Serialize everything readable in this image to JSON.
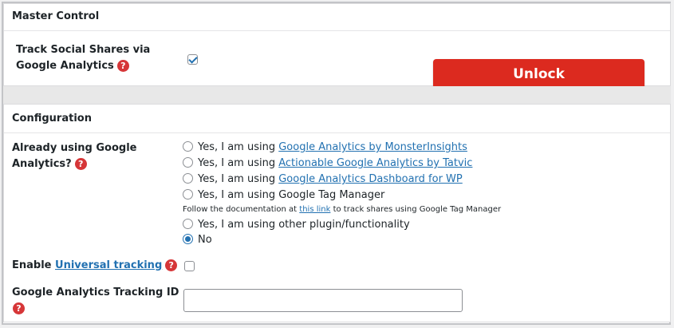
{
  "master": {
    "title": "Master Control",
    "track_label_line1": "Track Social Shares via",
    "track_label_line2": "Google Analytics",
    "track_checked": true,
    "unlock_label": "Unlock"
  },
  "config": {
    "title": "Configuration",
    "already_label_line1": "Already using Google",
    "already_label_line2": "Analytics?",
    "options": [
      {
        "prefix": "Yes, I am using ",
        "link": "Google Analytics by MonsterInsights",
        "selected": false
      },
      {
        "prefix": "Yes, I am using ",
        "link": "Actionable Google Analytics by Tatvic",
        "selected": false
      },
      {
        "prefix": "Yes, I am using ",
        "link": "Google Analytics Dashboard for WP",
        "selected": false
      },
      {
        "prefix": "Yes, I am using Google Tag Manager",
        "link": "",
        "selected": false
      }
    ],
    "note_before": "Follow the documentation at ",
    "note_link": "this link",
    "note_after": " to track shares using Google Tag Manager",
    "option_other": "Yes, I am using other plugin/functionality",
    "option_no": "No",
    "selected_option": "No",
    "enable_label": "Enable ",
    "enable_link": "Universal tracking",
    "enable_checked": false,
    "tracking_id_label": "Google Analytics Tracking ID",
    "tracking_id_value": ""
  },
  "colors": {
    "accent": "#2271b1",
    "unlock_button": "#dc2a1f",
    "help_icon": "#d63638"
  },
  "icons": {
    "help": "question-circle-icon",
    "check": "checkmark-icon"
  }
}
